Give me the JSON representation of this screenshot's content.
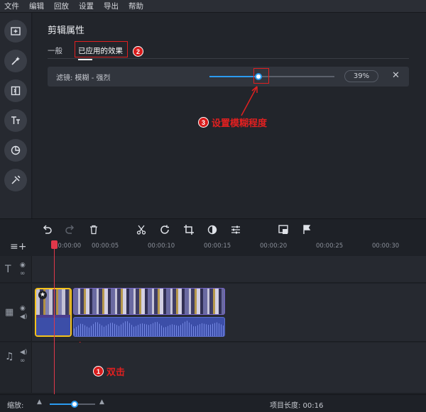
{
  "menu": [
    "文件",
    "编辑",
    "回放",
    "设置",
    "导出",
    "帮助"
  ],
  "sidebar": {
    "buttons": [
      "add-media-icon",
      "magic-wand-icon",
      "transition-icon",
      "titles-icon",
      "stickers-icon",
      "tools-icon"
    ]
  },
  "panel": {
    "title": "剪辑属性",
    "tabs": [
      "一般",
      "已应用的效果"
    ],
    "active_tab": 1,
    "effect": {
      "label": "滤镜: 模糊 - 强烈",
      "strength_percent": 39,
      "value_text": "39%",
      "remove_icon": "close-icon"
    }
  },
  "annotations": {
    "step1": {
      "number": "1",
      "text": "双击"
    },
    "step2": {
      "number": "2"
    },
    "step3": {
      "number": "3",
      "text": "设置模糊程度"
    }
  },
  "toolbar": [
    "undo-icon",
    "redo-icon",
    "delete-icon",
    "cut-icon",
    "rotate-icon",
    "crop-icon",
    "color-icon",
    "adjust-icon",
    "pip-icon",
    "flag-icon"
  ],
  "ruler": [
    "00:00:00",
    "00:00:05",
    "00:00:10",
    "00:00:15",
    "00:00:20",
    "00:00:25",
    "00:00:30"
  ],
  "colors": {
    "accent": "#2b9bf0",
    "selection": "#f4c21b",
    "playhead": "#e0384a",
    "annotation": "#e02020"
  },
  "status": {
    "zoom_label": "缩放:",
    "zoom_level": 0.55,
    "project_length": "项目长度: 00:16"
  }
}
